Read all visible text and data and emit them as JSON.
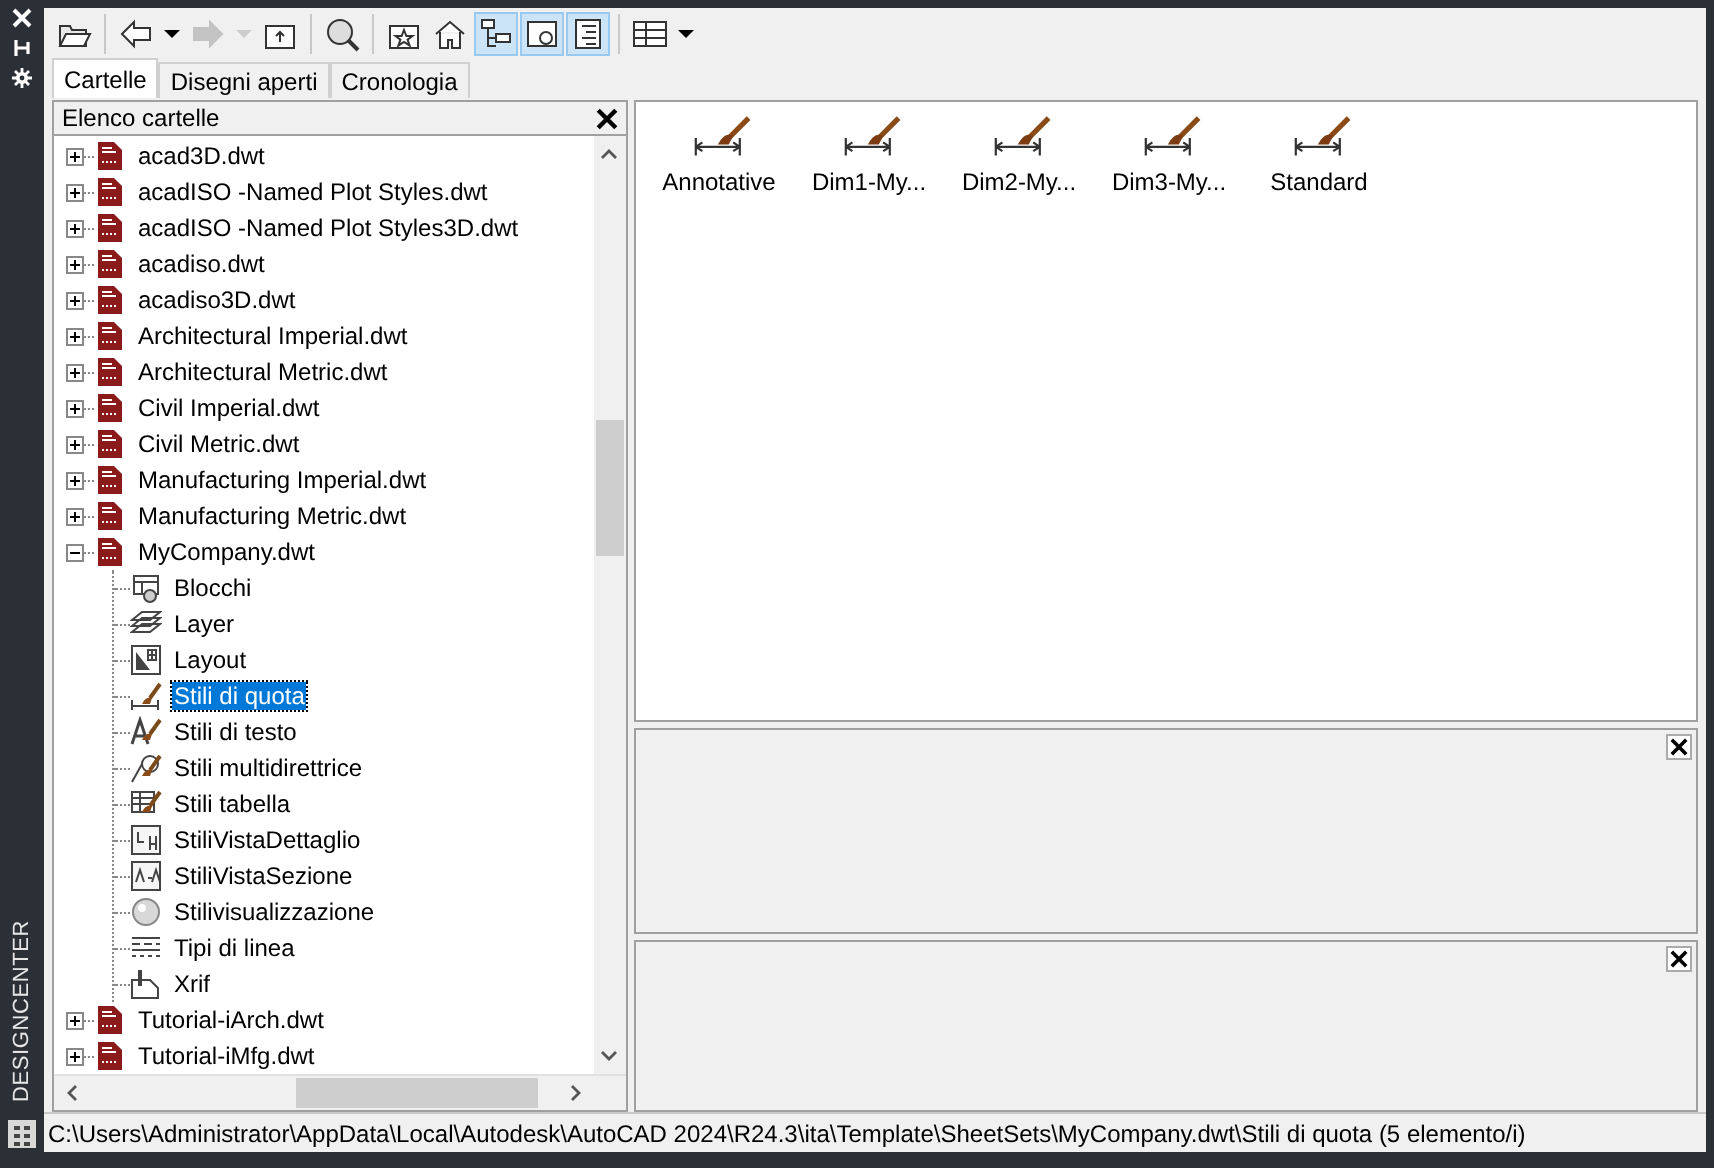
{
  "palette": {
    "title": "DESIGNCENTER"
  },
  "toolbar": [
    {
      "kind": "open",
      "selected": false,
      "disabled": false
    },
    {
      "kind": "back",
      "selected": false,
      "disabled": false
    },
    {
      "kind": "back-menu",
      "selected": false,
      "disabled": false
    },
    {
      "kind": "forward",
      "selected": false,
      "disabled": true
    },
    {
      "kind": "forward-menu",
      "selected": false,
      "disabled": true
    },
    {
      "kind": "up",
      "selected": false,
      "disabled": false
    },
    {
      "kind": "search",
      "selected": false,
      "disabled": false
    },
    {
      "kind": "favorites",
      "selected": false,
      "disabled": false
    },
    {
      "kind": "home",
      "selected": false,
      "disabled": false
    },
    {
      "kind": "tree",
      "selected": true,
      "disabled": false
    },
    {
      "kind": "preview",
      "selected": true,
      "disabled": false
    },
    {
      "kind": "description",
      "selected": true,
      "disabled": false
    },
    {
      "kind": "views",
      "selected": false,
      "disabled": false
    },
    {
      "kind": "views-menu",
      "selected": false,
      "disabled": false
    }
  ],
  "tabs": [
    {
      "label": "Cartelle",
      "selected": true
    },
    {
      "label": "Disegni aperti",
      "selected": false
    },
    {
      "label": "Cronologia",
      "selected": false
    }
  ],
  "folder_list": {
    "title": "Elenco cartelle",
    "items": [
      {
        "label": "acad3D.dwt",
        "kind": "file",
        "expanded": false,
        "selected": false
      },
      {
        "label": "acadISO -Named Plot Styles.dwt",
        "kind": "file",
        "expanded": false,
        "selected": false
      },
      {
        "label": "acadISO -Named Plot Styles3D.dwt",
        "kind": "file",
        "expanded": false,
        "selected": false
      },
      {
        "label": "acadiso.dwt",
        "kind": "file",
        "expanded": false,
        "selected": false
      },
      {
        "label": "acadiso3D.dwt",
        "kind": "file",
        "expanded": false,
        "selected": false
      },
      {
        "label": "Architectural Imperial.dwt",
        "kind": "file",
        "expanded": false,
        "selected": false
      },
      {
        "label": "Architectural Metric.dwt",
        "kind": "file",
        "expanded": false,
        "selected": false
      },
      {
        "label": "Civil Imperial.dwt",
        "kind": "file",
        "expanded": false,
        "selected": false
      },
      {
        "label": "Civil Metric.dwt",
        "kind": "file",
        "expanded": false,
        "selected": false
      },
      {
        "label": "Manufacturing Imperial.dwt",
        "kind": "file",
        "expanded": false,
        "selected": false
      },
      {
        "label": "Manufacturing Metric.dwt",
        "kind": "file",
        "expanded": false,
        "selected": false
      },
      {
        "label": "MyCompany.dwt",
        "kind": "file",
        "expanded": true,
        "selected": false,
        "children": [
          {
            "label": "Blocchi",
            "kind": "blocks",
            "selected": false
          },
          {
            "label": "Layer",
            "kind": "layers",
            "selected": false
          },
          {
            "label": "Layout",
            "kind": "layouts",
            "selected": false
          },
          {
            "label": "Stili di quota",
            "kind": "dimstyles",
            "selected": true
          },
          {
            "label": "Stili di testo",
            "kind": "textstyles",
            "selected": false
          },
          {
            "label": "Stili multidirettrice",
            "kind": "mleaderstyles",
            "selected": false
          },
          {
            "label": "Stili tabella",
            "kind": "tablestyles",
            "selected": false
          },
          {
            "label": "StiliVistaDettaglio",
            "kind": "detailstyles",
            "selected": false
          },
          {
            "label": "StiliVistaSezione",
            "kind": "sectionstyles",
            "selected": false
          },
          {
            "label": "Stilivisualizzazione",
            "kind": "visualstyles",
            "selected": false
          },
          {
            "label": "Tipi di linea",
            "kind": "linetypes",
            "selected": false
          },
          {
            "label": "Xrif",
            "kind": "xrefs",
            "selected": false
          }
        ]
      },
      {
        "label": "Tutorial-iArch.dwt",
        "kind": "file",
        "expanded": false,
        "selected": false
      },
      {
        "label": "Tutorial-iMfg.dwt",
        "kind": "file",
        "expanded": false,
        "selected": false
      }
    ]
  },
  "content": {
    "items": [
      {
        "label": "Annotative",
        "selected": false
      },
      {
        "label": "Dim1-My...",
        "selected": false
      },
      {
        "label": "Dim2-My...",
        "selected": false
      },
      {
        "label": "Dim3-My...",
        "selected": false
      },
      {
        "label": "Standard",
        "selected": false
      }
    ]
  },
  "status_bar": {
    "text": "C:\\Users\\Administrator\\AppData\\Local\\Autodesk\\AutoCAD 2024\\R24.3\\ita\\Template\\SheetSets\\MyCompany.dwt\\Stili di quota (5 elemento/i)"
  }
}
